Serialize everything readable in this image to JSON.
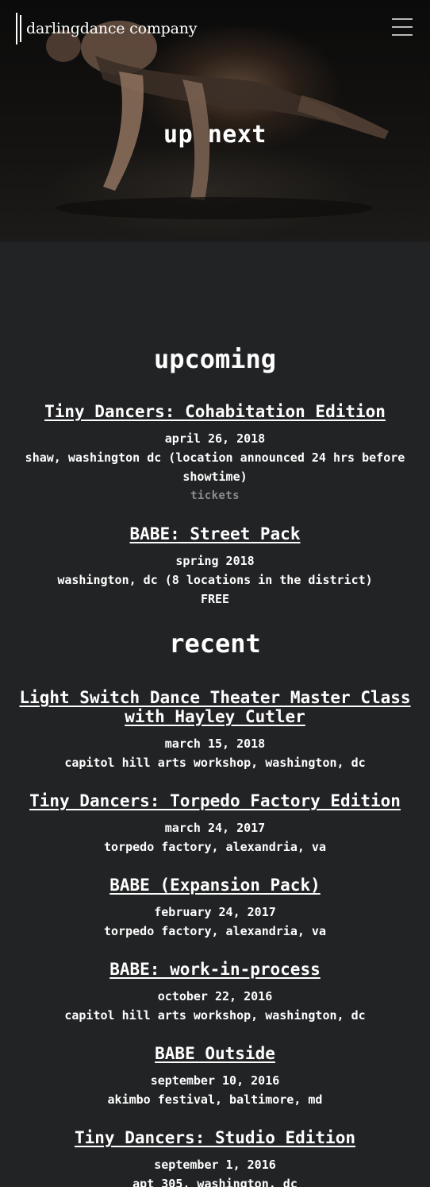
{
  "header": {
    "logo_text": "darlingdance company",
    "hero_title": "up next"
  },
  "upcoming": {
    "title": "upcoming",
    "events": [
      {
        "title": "Tiny Dancers: Cohabitation Edition",
        "date": "april 26, 2018",
        "location": "shaw, washington dc (location announced 24 hrs before showtime)",
        "link": "tickets"
      },
      {
        "title": "BABE: Street Pack",
        "date": "spring 2018",
        "location": "washington, dc (8 locations in the district)",
        "note": "FREE"
      }
    ]
  },
  "recent": {
    "title": "recent",
    "events": [
      {
        "title": "Light Switch Dance Theater Master Class with Hayley Cutler",
        "date": "march 15, 2018",
        "location": "capitol hill arts workshop, washington, dc"
      },
      {
        "title": "Tiny Dancers: Torpedo Factory Edition",
        "date": "march 24, 2017",
        "location": "torpedo factory, alexandria, va"
      },
      {
        "title": "BABE (Expansion Pack)",
        "date": "february 24, 2017",
        "location": "torpedo factory, alexandria, va"
      },
      {
        "title": "BABE: work-in-process",
        "date": "october 22, 2016",
        "location": "capitol hill arts workshop, washington, dc"
      },
      {
        "title": "BABE Outside",
        "date": "september 10, 2016",
        "location": "akimbo festival, baltimore, md"
      },
      {
        "title": "Tiny Dancers: Studio Edition",
        "date": "september 1, 2016",
        "location": "apt 305, washington, dc"
      }
    ]
  }
}
